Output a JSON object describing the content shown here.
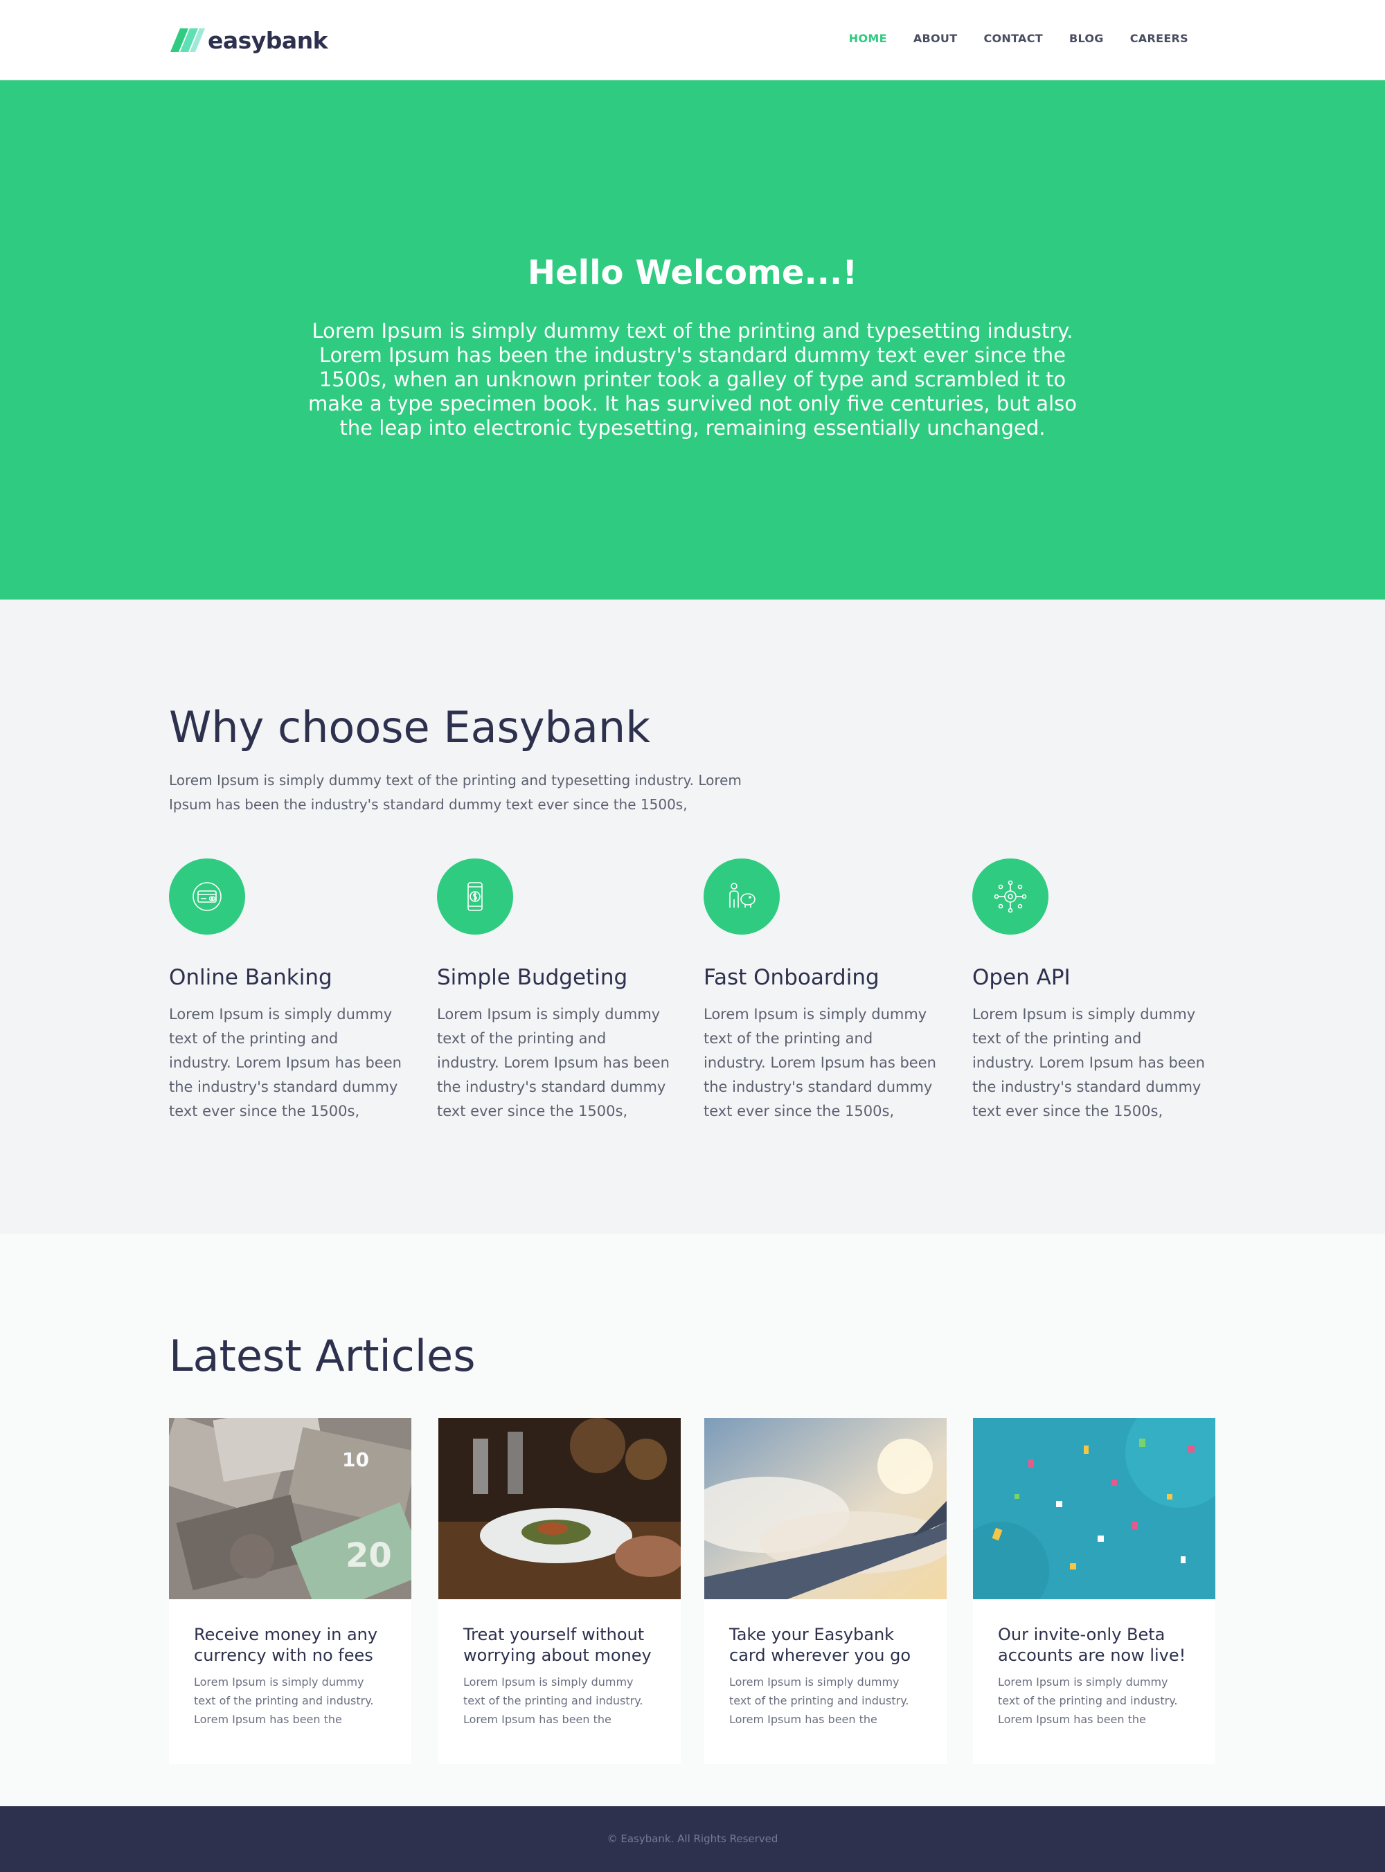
{
  "header": {
    "logo_text": "easybank",
    "nav": [
      {
        "label": "HOME",
        "active": true
      },
      {
        "label": "ABOUT",
        "active": false
      },
      {
        "label": "CONTACT",
        "active": false
      },
      {
        "label": "BLOG",
        "active": false
      },
      {
        "label": "CAREERS",
        "active": false
      }
    ]
  },
  "hero": {
    "title": "Hello Welcome...!",
    "text": "Lorem Ipsum is simply dummy text of the printing and typesetting industry. Lorem Ipsum has been the industry's standard dummy text ever since the 1500s, when an unknown printer took a galley of type and scrambled it to make a type specimen book. It has survived not only five centuries, but also the leap into electronic typesetting, remaining essentially unchanged."
  },
  "why": {
    "title": "Why choose Easybank",
    "intro": "Lorem Ipsum is simply dummy text of the printing and typesetting industry. Lorem Ipsum has been the industry's standard dummy text ever since the 1500s,",
    "features": [
      {
        "title": "Online Banking",
        "icon": "online-banking-icon",
        "text": "Lorem Ipsum is simply dummy text of the printing and industry. Lorem Ipsum has been the industry's standard dummy text ever since the 1500s,"
      },
      {
        "title": "Simple Budgeting",
        "icon": "budgeting-icon",
        "text": "Lorem Ipsum is simply dummy text of the printing and industry. Lorem Ipsum has been the industry's standard dummy text ever since the 1500s,"
      },
      {
        "title": "Fast Onboarding",
        "icon": "onboarding-icon",
        "text": "Lorem Ipsum is simply dummy text of the printing and industry. Lorem Ipsum has been the industry's standard dummy text ever since the 1500s,"
      },
      {
        "title": "Open API",
        "icon": "api-icon",
        "text": "Lorem Ipsum is simply dummy text of the printing and industry. Lorem Ipsum has been the industry's standard dummy text ever since the 1500s,"
      }
    ]
  },
  "articles": {
    "title": "Latest Articles",
    "items": [
      {
        "title": "Receive money in any currency with no fees",
        "text": "Lorem Ipsum is simply dummy text of the printing and industry. Lorem Ipsum has been the"
      },
      {
        "title": "Treat yourself without worrying about money",
        "text": "Lorem Ipsum is simply dummy text of the printing and industry. Lorem Ipsum has been the"
      },
      {
        "title": "Take your Easybank card wherever you go",
        "text": "Lorem Ipsum is simply dummy text of the printing and industry. Lorem Ipsum has been the"
      },
      {
        "title": "Our invite-only Beta accounts are now live!",
        "text": "Lorem Ipsum is simply dummy text of the printing and industry. Lorem Ipsum has been the"
      }
    ]
  },
  "footer": {
    "copyright": "© Easybank. All Rights Reserved"
  },
  "colors": {
    "accent": "#2ecb80",
    "dark": "#2d314d",
    "section_bg": "#f3f4f6"
  }
}
